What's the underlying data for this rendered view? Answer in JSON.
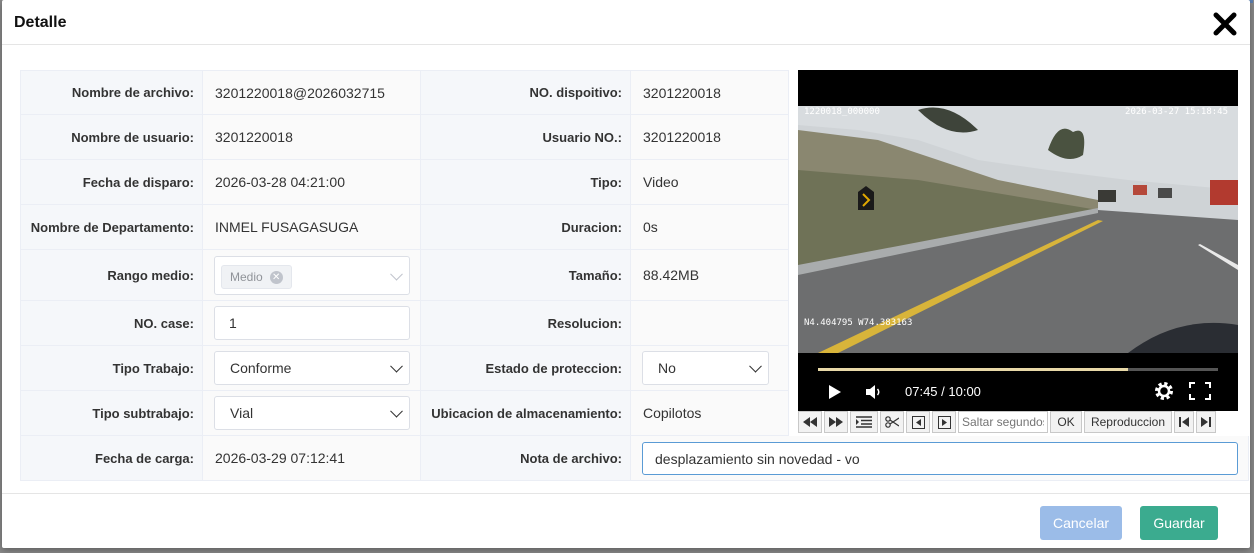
{
  "modal": {
    "title": "Detalle"
  },
  "left_rows": [
    {
      "label": "Nombre de archivo:",
      "value": "3201220018@2026032715"
    },
    {
      "label": "Nombre de usuario:",
      "value": "3201220018"
    },
    {
      "label": "Fecha de disparo:",
      "value": "2026-03-28 04:21:00"
    },
    {
      "label": "Nombre de Departamento:",
      "value": "INMEL FUSAGASUGA"
    },
    {
      "label": "Rango medio:",
      "tag": "Medio"
    },
    {
      "label": "NO. case:",
      "input_value": "1"
    },
    {
      "label": "Tipo Trabajo:",
      "select_value": "Conforme"
    },
    {
      "label": "Tipo subtrabajo:",
      "select_value": "Vial"
    },
    {
      "label": "Fecha de carga:",
      "value": "2026-03-29 07:12:41"
    }
  ],
  "right_rows": [
    {
      "label": "NO. dispoitivo:",
      "value": "3201220018"
    },
    {
      "label": "Usuario NO.:",
      "value": "3201220018"
    },
    {
      "label": "Tipo:",
      "value": "Video"
    },
    {
      "label": "Duracion:",
      "value": "0s"
    },
    {
      "label": "Tamaño:",
      "value": "88.42MB"
    },
    {
      "label": "Resolucion:",
      "value": ""
    },
    {
      "label": "Estado de proteccion:",
      "select_value": "No"
    },
    {
      "label": "Ubicacion de almacenamiento:",
      "value": "Copilotos"
    },
    {
      "label": "Nota de archivo:",
      "input_value": "desplazamiento sin novedad - vo"
    }
  ],
  "video": {
    "osd_channel": "1220018_000000",
    "osd_datetime": "2026-03-27  15:18:45",
    "osd_gps": "N4.404795  W74.383163",
    "time": "07:45 / 10:00",
    "progress": 0.775
  },
  "toolbar": {
    "seek_placeholder": "Saltar segundos",
    "ok_label": "OK",
    "playback_label": "Reproduccion"
  },
  "footer": {
    "cancel_label": "Cancelar",
    "save_label": "Guardar"
  },
  "colors": {
    "primary": "#3bab8f",
    "cancel": "#9bbce8",
    "focus": "#5a9bd5"
  }
}
